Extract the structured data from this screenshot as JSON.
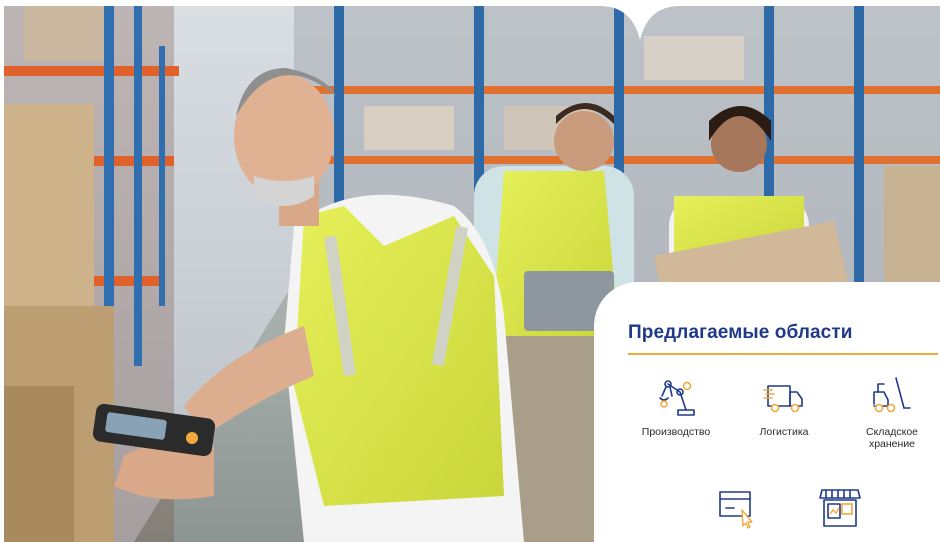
{
  "panel": {
    "title": "Предлагаемые области",
    "accent_color": "#f2a93b",
    "title_color": "#1f3a8a"
  },
  "areas": [
    {
      "label": "Производство",
      "icon": "robot-arm-icon"
    },
    {
      "label": "Логистика",
      "icon": "delivery-truck-icon"
    },
    {
      "label": "Складское хранение",
      "icon": "forklift-icon"
    },
    {
      "label": "",
      "icon": "ecommerce-box-cursor-icon"
    },
    {
      "label": "",
      "icon": "retail-store-icon"
    }
  ],
  "photo": {
    "subject": "warehouse-workers-scene"
  }
}
